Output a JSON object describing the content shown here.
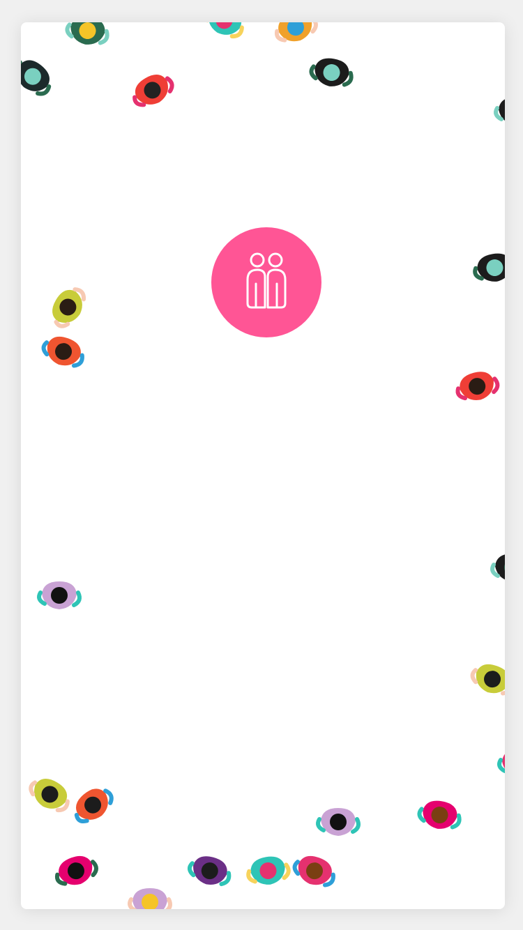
{
  "colors": {
    "background": "#f0f0f0",
    "card": "#ffffff",
    "logo_circle": "#ff5595",
    "logo_stroke": "#ffffff"
  },
  "logo": {
    "icon": "two-people-icon"
  },
  "crowd_icon": "person-top-view-icon"
}
